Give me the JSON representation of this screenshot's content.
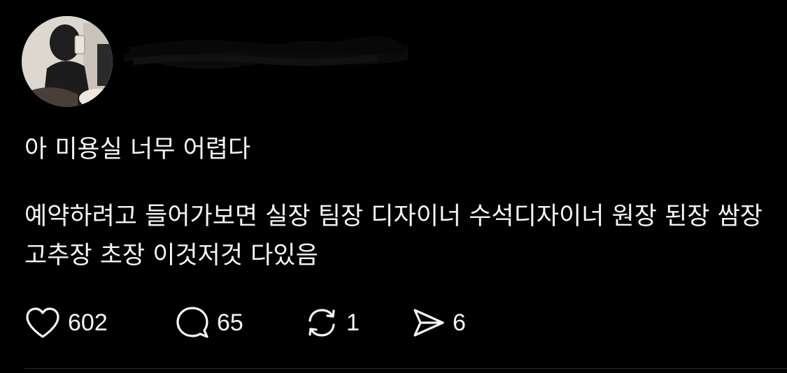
{
  "post": {
    "title": "아 미용실 너무 어렵다",
    "body": "예약하려고 들어가보면 실장 팀장 디자이너 수석디자이너 원장 된장 쌈장 고추장 초장 이것저것 다있음"
  },
  "actions": {
    "like": {
      "icon": "heart-icon",
      "count": "602"
    },
    "comment": {
      "icon": "speech-bubble-icon",
      "count": "65"
    },
    "repost": {
      "icon": "repost-icon",
      "count": "1"
    },
    "share": {
      "icon": "paper-plane-icon",
      "count": "6"
    }
  },
  "colors": {
    "background": "#000000",
    "text": "#f3f5f7",
    "divider": "#2b2b2b"
  }
}
